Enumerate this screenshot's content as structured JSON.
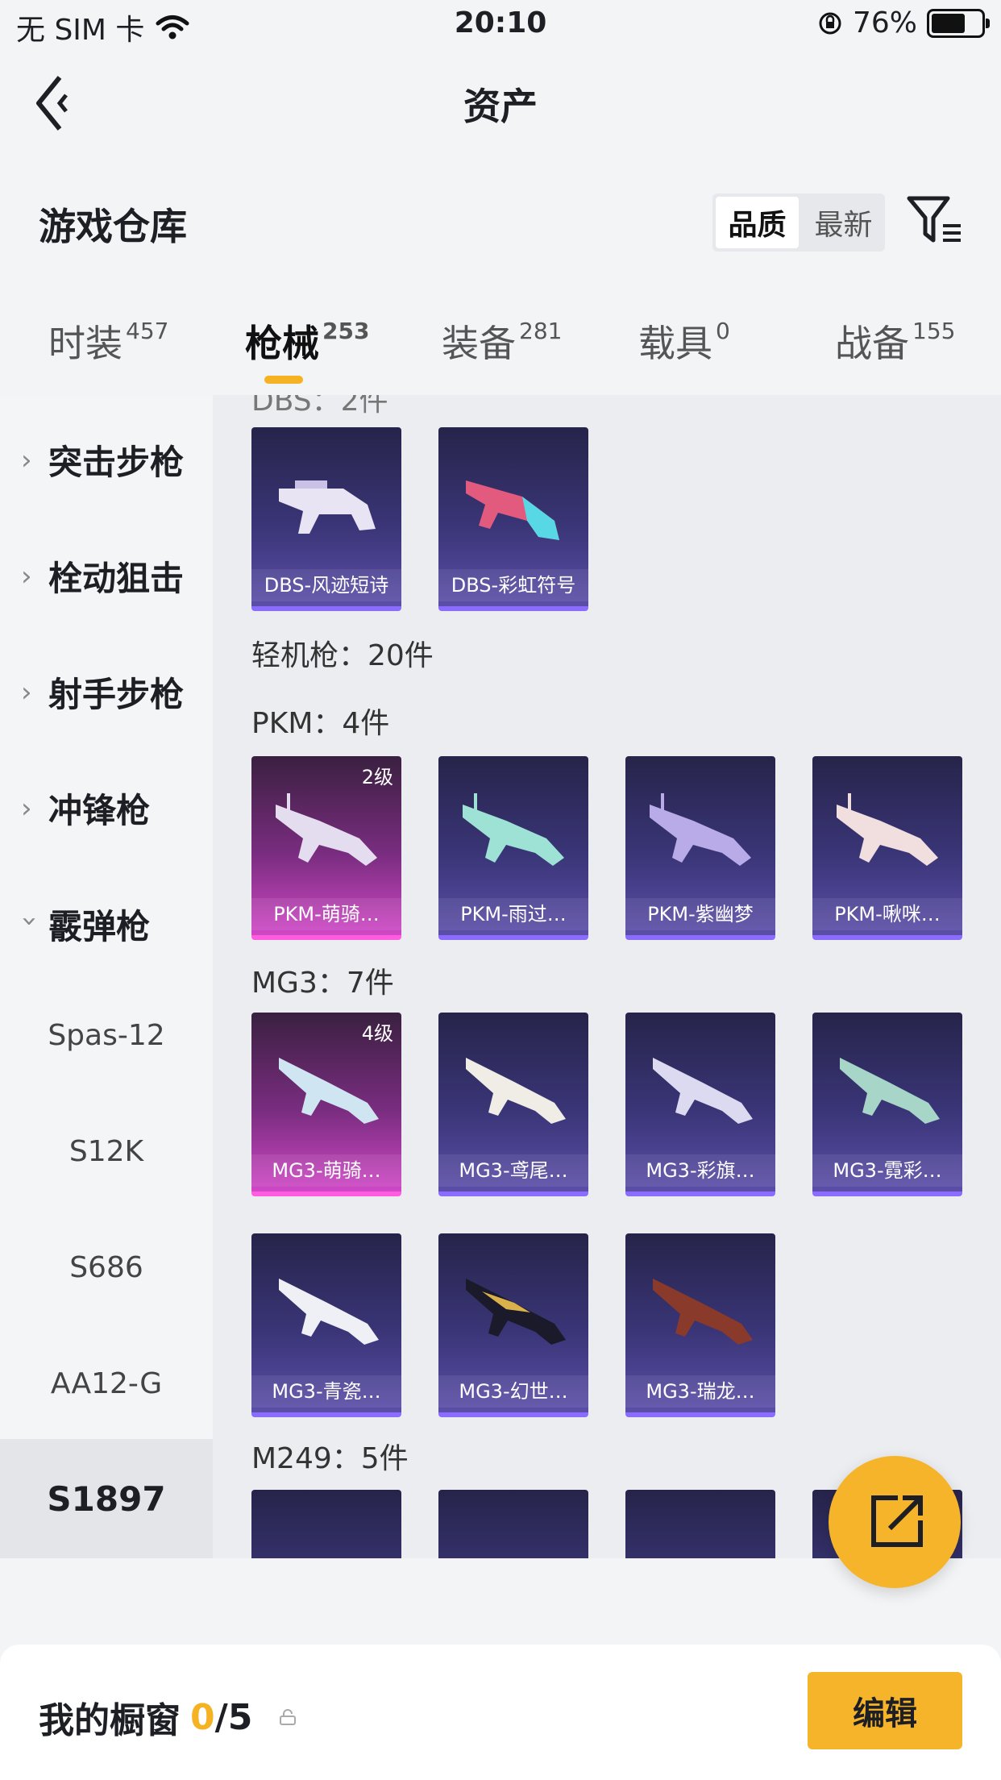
{
  "status_bar": {
    "carrier": "无 SIM 卡",
    "time": "20:10",
    "battery": "76%",
    "battery_level": 0.76
  },
  "nav": {
    "title": "资产"
  },
  "header": {
    "section_title": "游戏仓库",
    "sort_options": [
      "品质",
      "最新"
    ],
    "sort_selected": "品质"
  },
  "tabs": [
    {
      "label": "时装",
      "count": "457",
      "active": false
    },
    {
      "label": "枪械",
      "count": "253",
      "active": true
    },
    {
      "label": "装备",
      "count": "281",
      "active": false
    },
    {
      "label": "载具",
      "count": "0",
      "active": false
    },
    {
      "label": "战备",
      "count": "155",
      "active": false
    }
  ],
  "sidebar": {
    "categories": [
      {
        "label": "突击步枪",
        "expanded": false
      },
      {
        "label": "栓动狙击",
        "expanded": false
      },
      {
        "label": "射手步枪",
        "expanded": false
      },
      {
        "label": "冲锋枪",
        "expanded": false
      },
      {
        "label": "霰弹枪",
        "expanded": true
      }
    ],
    "sub_items": [
      "Spas-12",
      "S12K",
      "S686",
      "AA12-G",
      "S1897"
    ],
    "active_sub": "S1897"
  },
  "content": {
    "partial_header": "DBS：2件",
    "lmg_header": "轻机枪：20件",
    "dbs_items": [
      {
        "name": "DBS-风迹短诗"
      },
      {
        "name": "DBS-彩虹符号"
      }
    ],
    "pkm_header": "PKM：4件",
    "pkm_items": [
      {
        "name": "PKM-萌骑…",
        "level": "2级",
        "rarity": "pink"
      },
      {
        "name": "PKM-雨过…"
      },
      {
        "name": "PKM-紫幽梦"
      },
      {
        "name": "PKM-啾咪…"
      }
    ],
    "mg3_header": "MG3：7件",
    "mg3_items": [
      {
        "name": "MG3-萌骑…",
        "level": "4级",
        "rarity": "pink"
      },
      {
        "name": "MG3-鸢尾…"
      },
      {
        "name": "MG3-彩旗…"
      },
      {
        "name": "MG3-霓彩…"
      },
      {
        "name": "MG3-青瓷…"
      },
      {
        "name": "MG3-幻世…"
      },
      {
        "name": "MG3-瑞龙…"
      }
    ],
    "m249_header": "M249：5件"
  },
  "showcase": {
    "label": "我的橱窗",
    "used": "0",
    "total": "/5"
  },
  "edit_button": "编辑",
  "colors": {
    "accent": "#f6b42a",
    "card_purple": "#3a3577",
    "card_pink": "#d048c6"
  },
  "icons": [
    "back-arrow-icon",
    "filter-icon",
    "share-icon",
    "lock-icon",
    "wifi-icon",
    "rotation-lock-icon"
  ]
}
